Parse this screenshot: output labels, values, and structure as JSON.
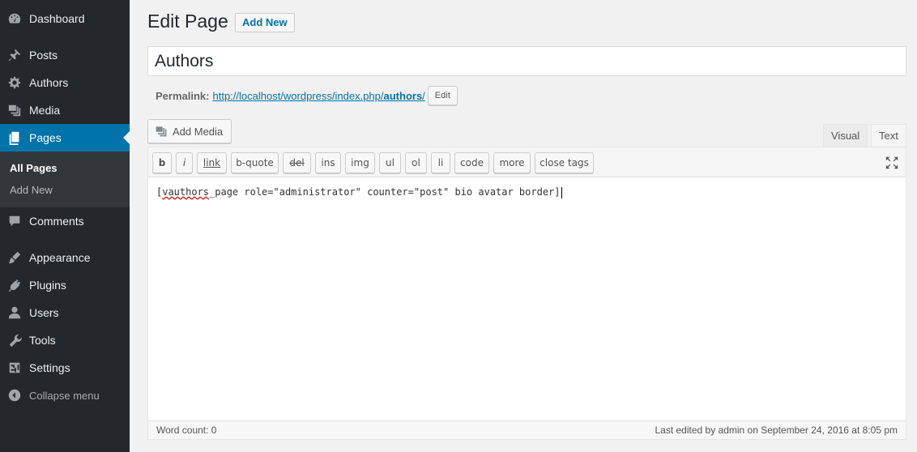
{
  "sidebar": {
    "items": [
      {
        "label": "Dashboard",
        "icon": "dashboard-icon"
      },
      {
        "label": "Posts",
        "icon": "pin-icon"
      },
      {
        "label": "Authors",
        "icon": "gear-icon"
      },
      {
        "label": "Media",
        "icon": "media-icon"
      },
      {
        "label": "Pages",
        "icon": "pages-icon"
      },
      {
        "label": "Comments",
        "icon": "comment-icon"
      },
      {
        "label": "Appearance",
        "icon": "brush-icon"
      },
      {
        "label": "Plugins",
        "icon": "plug-icon"
      },
      {
        "label": "Users",
        "icon": "user-icon"
      },
      {
        "label": "Tools",
        "icon": "wrench-icon"
      },
      {
        "label": "Settings",
        "icon": "settings-icon"
      }
    ],
    "submenu": {
      "all_pages": "All Pages",
      "add_new": "Add New"
    },
    "collapse": "Collapse menu"
  },
  "header": {
    "title": "Edit Page",
    "add_new": "Add New"
  },
  "post": {
    "title": "Authors"
  },
  "permalink": {
    "label": "Permalink:",
    "url_base": "http://localhost/wordpress/index.php/",
    "slug": "authors",
    "url_end": "/",
    "edit": "Edit"
  },
  "media": {
    "add_media": "Add Media"
  },
  "tabs": {
    "visual": "Visual",
    "text": "Text"
  },
  "quicktags": [
    "b",
    "i",
    "link",
    "b-quote",
    "del",
    "ins",
    "img",
    "ul",
    "ol",
    "li",
    "code",
    "more",
    "close tags"
  ],
  "content": {
    "bracket_open": "[",
    "spell_word": "vauthors",
    "rest": "_page role=\"administrator\" counter=\"post\" bio avatar border]"
  },
  "status": {
    "word_count": "Word count: 0",
    "last_edited": "Last edited by admin on September 24, 2016 at 8:05 pm"
  },
  "colors": {
    "sidebar_bg": "#23282d",
    "accent": "#0073aa",
    "submenu_bg": "#32373c"
  }
}
